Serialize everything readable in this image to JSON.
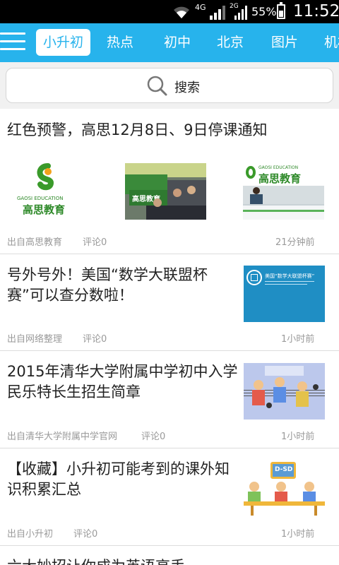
{
  "status_bar": {
    "network_1": "4G",
    "network_2": "2G",
    "battery_percent": "55%",
    "battery_level": 0.55,
    "time": "11:52"
  },
  "nav": {
    "tabs": [
      {
        "label": "小升初",
        "active": true
      },
      {
        "label": "热点"
      },
      {
        "label": "初中"
      },
      {
        "label": "北京"
      },
      {
        "label": "图片"
      },
      {
        "label": "机构"
      }
    ]
  },
  "search": {
    "label": "搜索"
  },
  "articles": [
    {
      "title": "红色预警，高思12月8日、9日停课通知",
      "source": "出自高思教育",
      "comments": "评论0",
      "time": "21分钟前",
      "images": [
        {
          "logo_text": "GAOSI EDUCATION",
          "logo_name": "高思教育"
        },
        {
          "sign_text": "高思教育"
        },
        {
          "logo_text": "GAOSI EDUCATION",
          "logo_name": "高思教育"
        }
      ]
    },
    {
      "title_line1": "号外号外！美国“数学大联盟杯",
      "title_line2": "赛”可以查分数啦！",
      "source": "出自网络整理",
      "comments": "评论0",
      "time": "1小时前",
      "image_text": "美国“数学大联盟杯赛”"
    },
    {
      "title_line1": "2015年清华大学附属中学初中入学",
      "title_line2": "民乐特长生招生简章",
      "source": "出自清华大学附属中学官网",
      "comments": "评论0",
      "time": "1小时前"
    },
    {
      "title_line1": "【收藏】小升初可能考到的课外知",
      "title_line2": "识积累汇总",
      "source": "出自小升初",
      "comments": "评论0",
      "time": "1小时前"
    },
    {
      "title": "六大妙招让你成为英语高手"
    }
  ],
  "colors": {
    "nav_bg": "#27b3ec",
    "divider": "#dcdcdc",
    "meta_text": "#9a9a9a"
  }
}
